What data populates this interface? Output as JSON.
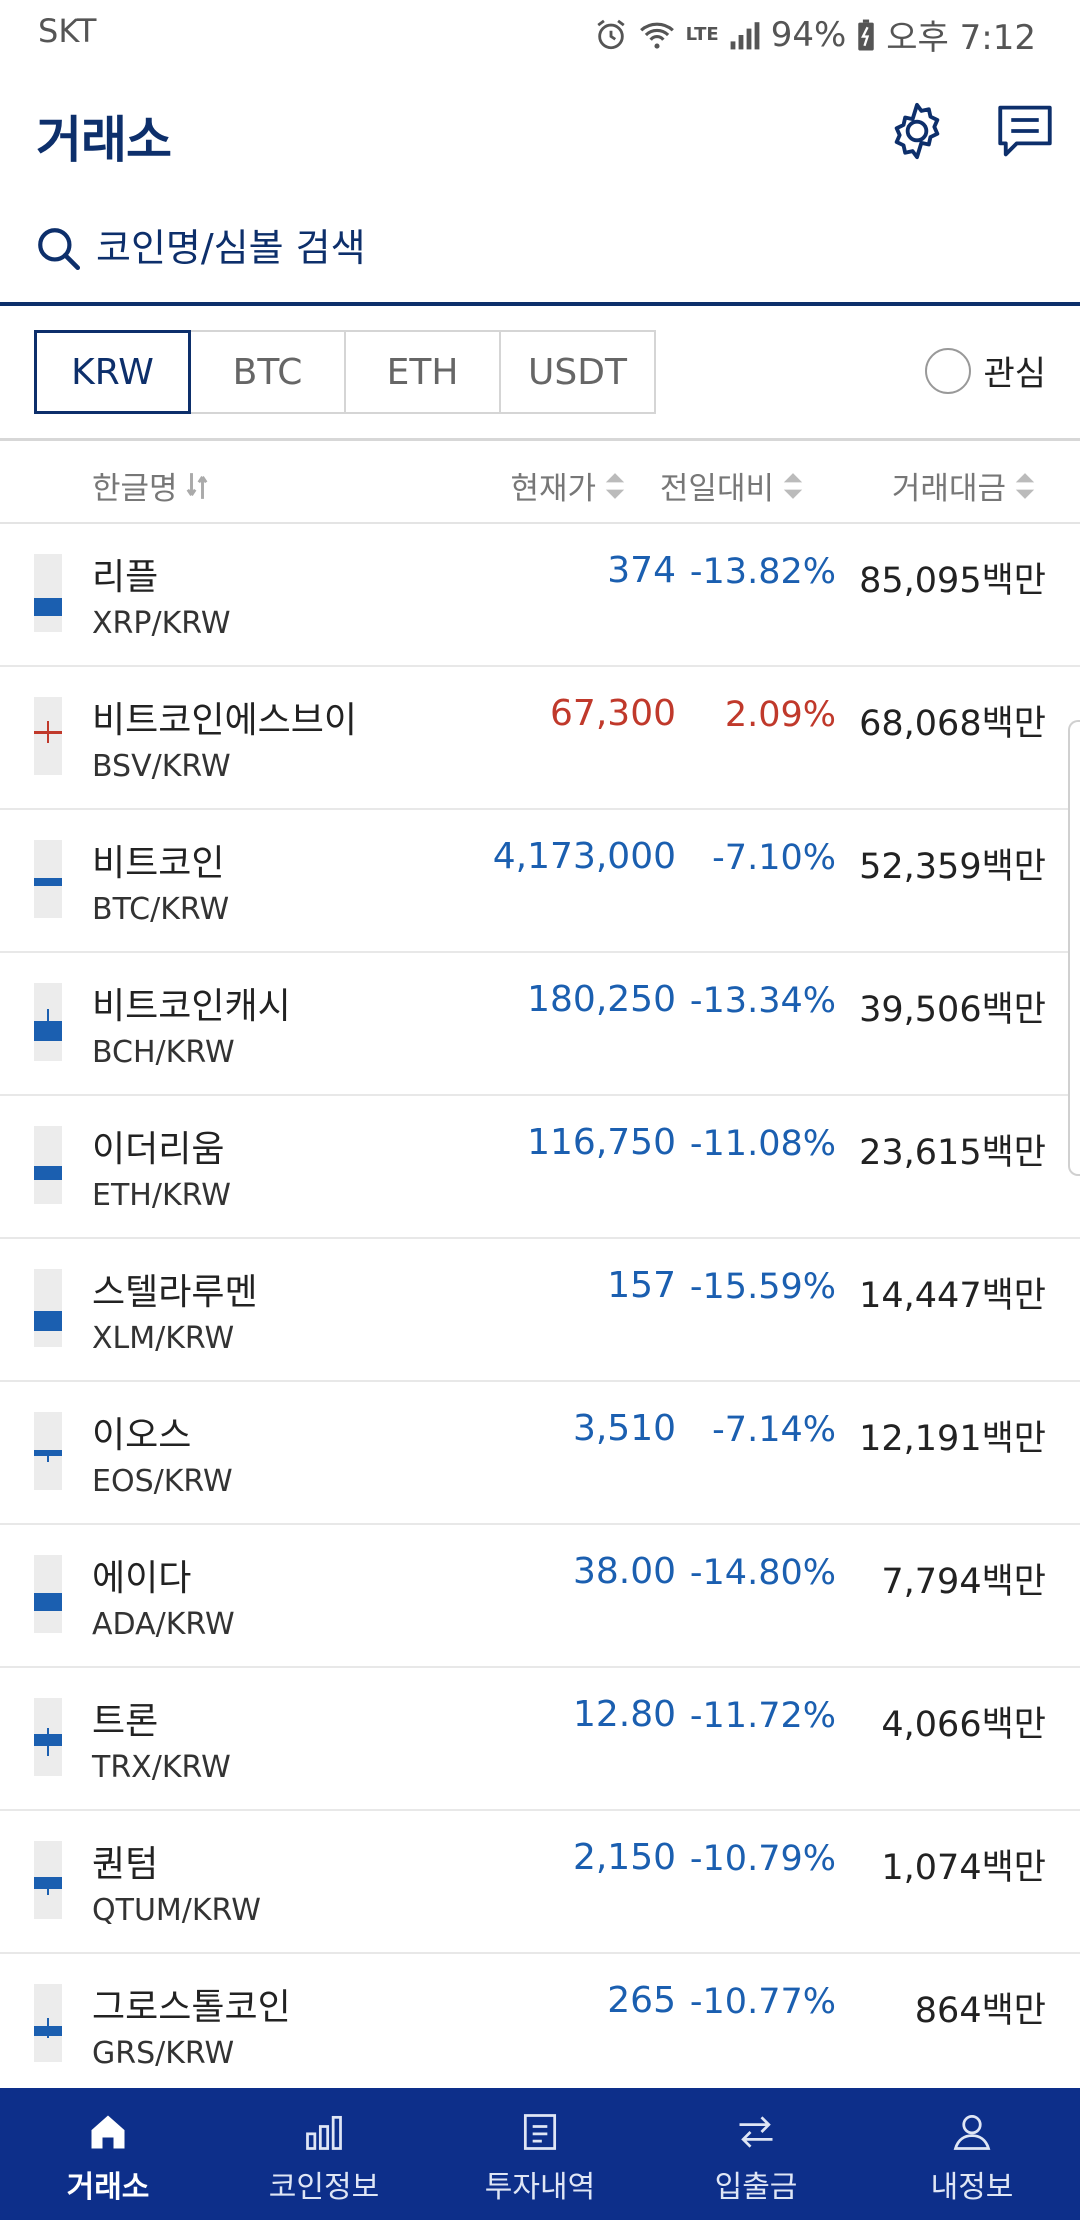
{
  "status_bar": {
    "carrier": "SKT",
    "battery": "94%",
    "time": "오후 7:12",
    "network": "LTE"
  },
  "header": {
    "title": "거래소",
    "icons": [
      "gear-icon",
      "chat-icon"
    ]
  },
  "search": {
    "placeholder": "코인명/심볼 검색"
  },
  "market_tabs": [
    {
      "label": "KRW",
      "active": true
    },
    {
      "label": "BTC",
      "active": false
    },
    {
      "label": "ETH",
      "active": false
    },
    {
      "label": "USDT",
      "active": false
    }
  ],
  "favorites": {
    "label": "관심",
    "checked": false
  },
  "columns": {
    "name": "한글명",
    "price": "현재가",
    "change": "전일대비",
    "volume": "거래대금"
  },
  "colors": {
    "brand": "#0d2f6b",
    "down": "#1b5fb0",
    "up": "#c0392b",
    "nav_bg": "#0d2f8a"
  },
  "coins": [
    {
      "name": "리플",
      "pair": "XRP/KRW",
      "price": "374",
      "change": "-13.82%",
      "volume": "85,095백만",
      "direction": "down"
    },
    {
      "name": "비트코인에스브이",
      "pair": "BSV/KRW",
      "price": "67,300",
      "change": "2.09%",
      "volume": "68,068백만",
      "direction": "up"
    },
    {
      "name": "비트코인",
      "pair": "BTC/KRW",
      "price": "4,173,000",
      "change": "-7.10%",
      "volume": "52,359백만",
      "direction": "down"
    },
    {
      "name": "비트코인캐시",
      "pair": "BCH/KRW",
      "price": "180,250",
      "change": "-13.34%",
      "volume": "39,506백만",
      "direction": "down"
    },
    {
      "name": "이더리움",
      "pair": "ETH/KRW",
      "price": "116,750",
      "change": "-11.08%",
      "volume": "23,615백만",
      "direction": "down"
    },
    {
      "name": "스텔라루멘",
      "pair": "XLM/KRW",
      "price": "157",
      "change": "-15.59%",
      "volume": "14,447백만",
      "direction": "down"
    },
    {
      "name": "이오스",
      "pair": "EOS/KRW",
      "price": "3,510",
      "change": "-7.14%",
      "volume": "12,191백만",
      "direction": "down"
    },
    {
      "name": "에이다",
      "pair": "ADA/KRW",
      "price": "38.00",
      "change": "-14.80%",
      "volume": "7,794백만",
      "direction": "down"
    },
    {
      "name": "트론",
      "pair": "TRX/KRW",
      "price": "12.80",
      "change": "-11.72%",
      "volume": "4,066백만",
      "direction": "down"
    },
    {
      "name": "퀀텀",
      "pair": "QTUM/KRW",
      "price": "2,150",
      "change": "-10.79%",
      "volume": "1,074백만",
      "direction": "down"
    },
    {
      "name": "그로스톨코인",
      "pair": "GRS/KRW",
      "price": "265",
      "change": "-10.77%",
      "volume": "864백만",
      "direction": "down"
    }
  ],
  "bottom_nav": [
    {
      "label": "거래소",
      "icon": "home-icon",
      "active": true
    },
    {
      "label": "코인정보",
      "icon": "bar-chart-icon",
      "active": false
    },
    {
      "label": "투자내역",
      "icon": "document-icon",
      "active": false
    },
    {
      "label": "입출금",
      "icon": "transfer-icon",
      "active": false
    },
    {
      "label": "내정보",
      "icon": "user-icon",
      "active": false
    }
  ]
}
